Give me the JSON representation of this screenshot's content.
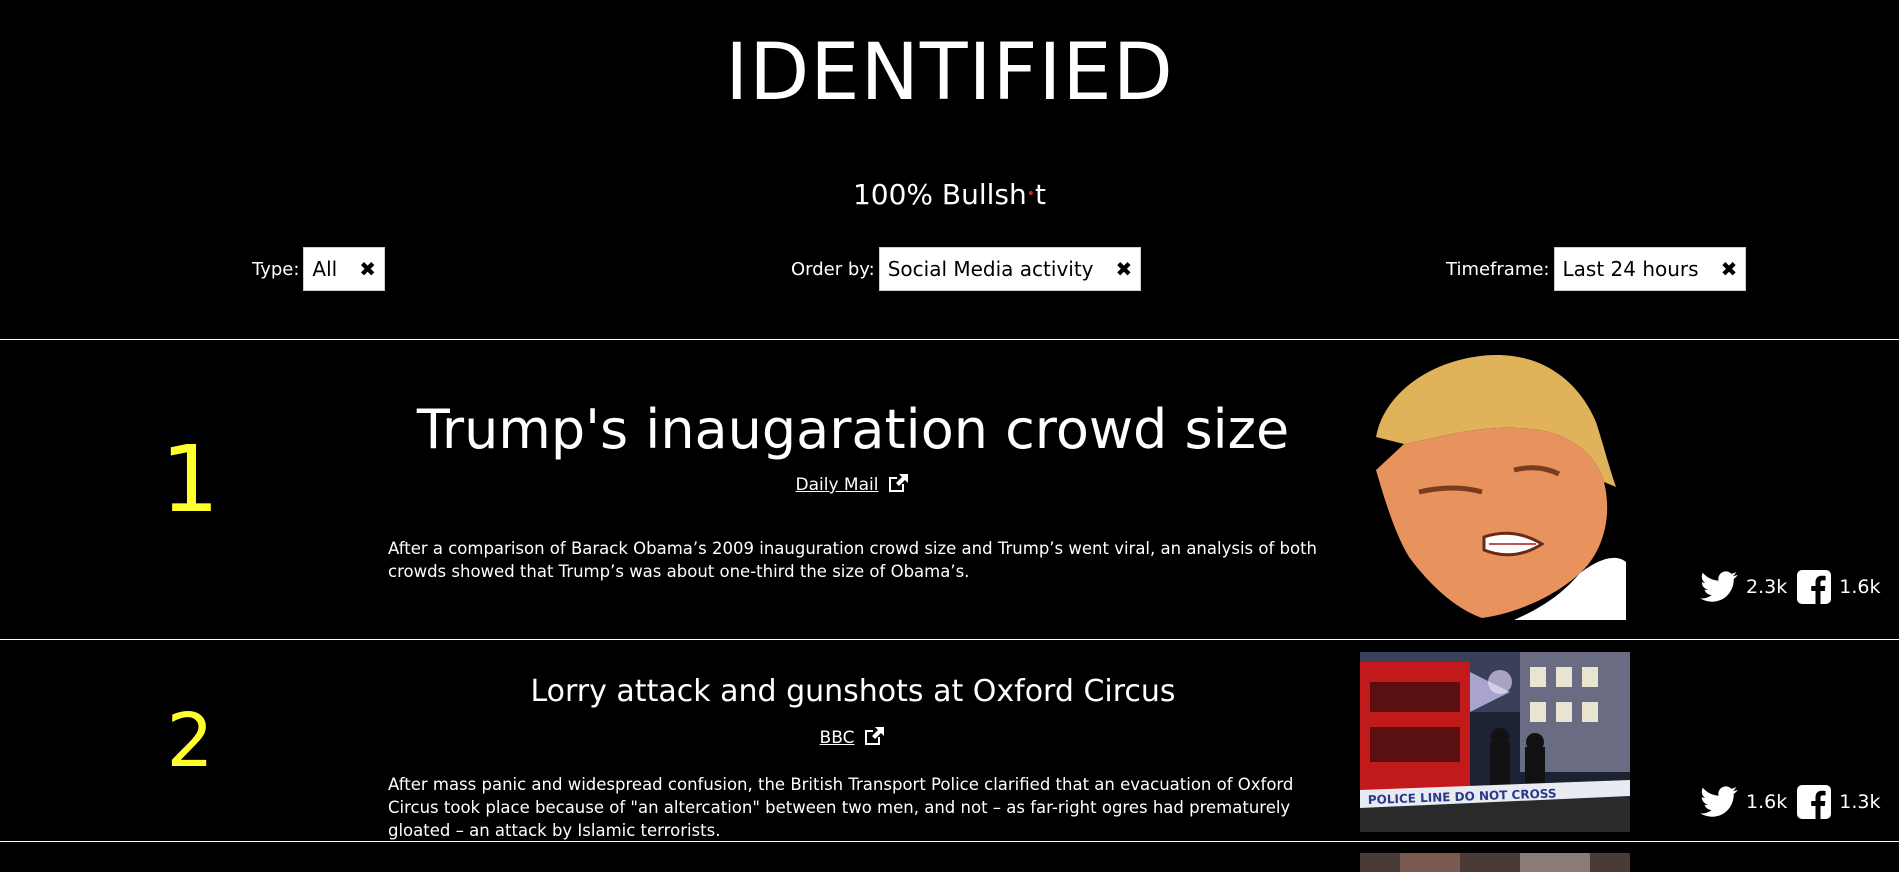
{
  "site": {
    "title": "IDENTIFIED",
    "tagline_start": "100% Bullsh",
    "tagline_end": "t"
  },
  "filters": [
    {
      "label": "Type:",
      "value": "All",
      "clear_icon": "close-icon"
    },
    {
      "label": "Order by:",
      "value": "Social Media activity",
      "clear_icon": "close-icon"
    },
    {
      "label": "Timeframe:",
      "value": "Last 24 hours",
      "clear_icon": "close-icon"
    }
  ],
  "stories": [
    {
      "rank": "1",
      "title": "Trump's inaugaration crowd size",
      "source": "Daily Mail",
      "description": "After a comparison of Barack Obama’s 2009 inauguration crowd size and Trump’s went viral, an analysis of both crowds showed that Trump’s was about one-third the size of Obama’s.",
      "twitter_count": "2.3k",
      "facebook_count": "1.6k",
      "image": "trump-face-cutout"
    },
    {
      "rank": "2",
      "title": "Lorry attack and gunshots at Oxford Circus",
      "source": "BBC",
      "description": "After mass panic and widespread confusion, the British Transport Police clarified that an evacuation of Oxford Circus took place because of \"an altercation\" between two men, and not – as far-right ogres had prematurely gloated – an attack by Islamic terrorists.",
      "twitter_count": "1.6k",
      "facebook_count": "1.3k",
      "image": "oxford-circus-police-photo",
      "image_tape_text": "POLICE LINE DO NOT CROSS"
    }
  ],
  "colors": {
    "background": "#000000",
    "text": "#ffffff",
    "rank": "#ffff2e",
    "tagline_dot": "#dd2222"
  }
}
